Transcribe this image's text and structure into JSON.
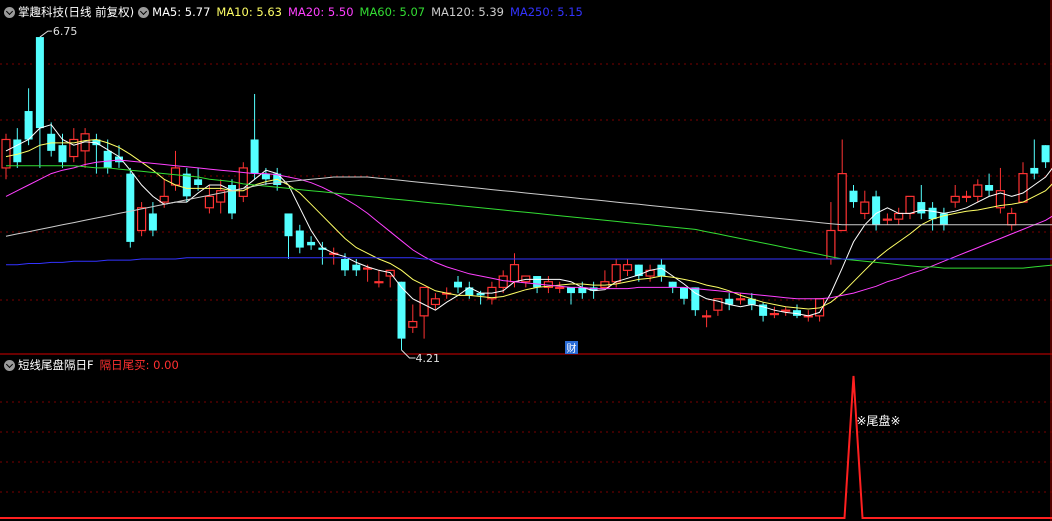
{
  "main_header": {
    "stock_title": "掌趣科技(日线 前复权)",
    "indicators": [
      {
        "label": "MA5: 5.77",
        "color": "#ffffff"
      },
      {
        "label": "MA10: 5.63",
        "color": "#ffff66"
      },
      {
        "label": "MA20: 5.50",
        "color": "#ff40ff"
      },
      {
        "label": "MA60: 5.07",
        "color": "#33dd33"
      },
      {
        "label": "MA120: 5.39",
        "color": "#cccccc"
      },
      {
        "label": "MA250: 5.15",
        "color": "#3333ff"
      }
    ]
  },
  "sub_header": {
    "title": "短线尾盘隔日F",
    "value_label": "隔日尾买: 0.00",
    "value_color": "#ff3030"
  },
  "colors": {
    "up": "#ff3333",
    "down": "#54ffff",
    "grid": "#7a0000",
    "panel_border": "#aa0000",
    "signal": "#ff2020",
    "finance_badge": "#2a6cd6"
  },
  "chart_data": {
    "type": "candlestick",
    "price_range": [
      4.0,
      6.9
    ],
    "high_label": "6.75",
    "low_label": "4.21",
    "finance_marker": {
      "label": "财",
      "at_index": 50
    },
    "candles": [
      [
        5.6,
        5.85,
        5.9,
        5.5
      ],
      [
        5.85,
        5.65,
        5.95,
        5.6
      ],
      [
        6.1,
        5.85,
        6.3,
        5.8
      ],
      [
        6.75,
        5.95,
        6.75,
        5.6
      ],
      [
        5.9,
        5.75,
        6.0,
        5.7
      ],
      [
        5.8,
        5.65,
        5.9,
        5.6
      ],
      [
        5.7,
        5.85,
        5.95,
        5.65
      ],
      [
        5.75,
        5.9,
        5.95,
        5.6
      ],
      [
        5.85,
        5.8,
        5.9,
        5.55
      ],
      [
        5.75,
        5.6,
        5.85,
        5.55
      ],
      [
        5.7,
        5.65,
        5.8,
        5.6
      ],
      [
        5.55,
        4.95,
        5.6,
        4.9
      ],
      [
        5.05,
        5.25,
        5.3,
        5.0
      ],
      [
        5.2,
        5.05,
        5.3,
        5.0
      ],
      [
        5.3,
        5.35,
        5.5,
        5.25
      ],
      [
        5.45,
        5.6,
        5.75,
        5.4
      ],
      [
        5.55,
        5.35,
        5.6,
        5.3
      ],
      [
        5.5,
        5.45,
        5.6,
        5.4
      ],
      [
        5.25,
        5.35,
        5.45,
        5.2
      ],
      [
        5.3,
        5.4,
        5.5,
        5.2
      ],
      [
        5.45,
        5.2,
        5.5,
        5.15
      ],
      [
        5.35,
        5.6,
        5.65,
        5.3
      ],
      [
        5.85,
        5.55,
        6.25,
        5.5
      ],
      [
        5.55,
        5.5,
        5.6,
        5.45
      ],
      [
        5.55,
        5.45,
        5.6,
        5.4
      ],
      [
        5.2,
        5.0,
        5.2,
        4.8
      ],
      [
        5.05,
        4.9,
        5.1,
        4.85
      ],
      [
        4.95,
        4.92,
        5.0,
        4.88
      ],
      [
        4.9,
        4.88,
        4.95,
        4.75
      ],
      [
        4.85,
        4.85,
        4.9,
        4.75
      ],
      [
        4.8,
        4.7,
        4.85,
        4.65
      ],
      [
        4.75,
        4.7,
        4.8,
        4.65
      ],
      [
        4.72,
        4.72,
        4.75,
        4.6
      ],
      [
        4.6,
        4.6,
        4.7,
        4.55
      ],
      [
        4.65,
        4.7,
        4.7,
        4.55
      ],
      [
        4.6,
        4.1,
        4.6,
        4.0
      ],
      [
        4.2,
        4.25,
        4.4,
        4.15
      ],
      [
        4.3,
        4.55,
        4.55,
        4.1
      ],
      [
        4.4,
        4.45,
        4.5,
        4.35
      ],
      [
        4.5,
        4.5,
        4.55,
        4.45
      ],
      [
        4.6,
        4.55,
        4.65,
        4.5
      ],
      [
        4.55,
        4.48,
        4.6,
        4.45
      ],
      [
        4.5,
        4.48,
        4.52,
        4.4
      ],
      [
        4.45,
        4.55,
        4.6,
        4.4
      ],
      [
        4.55,
        4.65,
        4.7,
        4.5
      ],
      [
        4.6,
        4.75,
        4.85,
        4.55
      ],
      [
        4.6,
        4.65,
        4.65,
        4.55
      ],
      [
        4.65,
        4.55,
        4.6,
        4.5
      ],
      [
        4.55,
        4.6,
        4.65,
        4.5
      ],
      [
        4.55,
        4.55,
        4.6,
        4.5
      ],
      [
        4.55,
        4.5,
        4.55,
        4.4
      ],
      [
        4.55,
        4.5,
        4.6,
        4.45
      ],
      [
        4.55,
        4.52,
        4.6,
        4.45
      ],
      [
        4.55,
        4.6,
        4.7,
        4.55
      ],
      [
        4.6,
        4.75,
        4.8,
        4.55
      ],
      [
        4.7,
        4.75,
        4.8,
        4.65
      ],
      [
        4.75,
        4.65,
        4.75,
        4.6
      ],
      [
        4.65,
        4.7,
        4.75,
        4.6
      ],
      [
        4.75,
        4.65,
        4.8,
        4.6
      ],
      [
        4.6,
        4.55,
        4.6,
        4.5
      ],
      [
        4.55,
        4.45,
        4.55,
        4.4
      ],
      [
        4.55,
        4.35,
        4.55,
        4.3
      ],
      [
        4.3,
        4.3,
        4.35,
        4.2
      ],
      [
        4.35,
        4.45,
        4.45,
        4.3
      ],
      [
        4.45,
        4.4,
        4.5,
        4.35
      ],
      [
        4.45,
        4.45,
        4.5,
        4.4
      ],
      [
        4.45,
        4.4,
        4.5,
        4.35
      ],
      [
        4.4,
        4.3,
        4.42,
        4.25
      ],
      [
        4.32,
        4.32,
        4.38,
        4.28
      ],
      [
        4.35,
        4.35,
        4.38,
        4.3
      ],
      [
        4.35,
        4.3,
        4.4,
        4.28
      ],
      [
        4.3,
        4.3,
        4.35,
        4.25
      ],
      [
        4.3,
        4.45,
        4.45,
        4.25
      ],
      [
        4.8,
        5.05,
        5.3,
        4.75
      ],
      [
        5.05,
        5.55,
        5.85,
        5.05
      ],
      [
        5.4,
        5.3,
        5.45,
        5.25
      ],
      [
        5.2,
        5.3,
        5.4,
        5.15
      ],
      [
        5.35,
        5.1,
        5.4,
        5.05
      ],
      [
        5.15,
        5.15,
        5.2,
        5.1
      ],
      [
        5.15,
        5.2,
        5.25,
        5.1
      ],
      [
        5.2,
        5.35,
        5.35,
        5.15
      ],
      [
        5.3,
        5.2,
        5.45,
        5.15
      ],
      [
        5.25,
        5.15,
        5.3,
        5.05
      ],
      [
        5.2,
        5.1,
        5.25,
        5.05
      ],
      [
        5.3,
        5.35,
        5.45,
        5.25
      ],
      [
        5.35,
        5.35,
        5.4,
        5.3
      ],
      [
        5.35,
        5.45,
        5.5,
        5.3
      ],
      [
        5.45,
        5.4,
        5.55,
        5.35
      ],
      [
        5.25,
        5.4,
        5.6,
        5.2
      ],
      [
        5.1,
        5.2,
        5.25,
        5.05
      ],
      [
        5.3,
        5.55,
        5.65,
        5.3
      ],
      [
        5.6,
        5.55,
        5.85,
        5.5
      ],
      [
        5.8,
        5.65,
        5.8,
        5.6
      ],
      [
        5.65,
        5.77,
        5.85,
        5.6
      ]
    ],
    "moving_averages": [
      {
        "name": "MA5",
        "color": "#ffffff",
        "values": [
          5.75,
          5.8,
          5.85,
          5.95,
          5.98,
          5.85,
          5.8,
          5.83,
          5.82,
          5.76,
          5.7,
          5.58,
          5.45,
          5.35,
          5.28,
          5.3,
          5.3,
          5.38,
          5.45,
          5.45,
          5.4,
          5.42,
          5.5,
          5.58,
          5.55,
          5.45,
          5.25,
          5.05,
          4.9,
          4.85,
          4.82,
          4.77,
          4.73,
          4.7,
          4.68,
          4.55,
          4.45,
          4.4,
          4.35,
          4.42,
          4.48,
          4.55,
          4.5,
          4.5,
          4.52,
          4.6,
          4.62,
          4.62,
          4.62,
          4.62,
          4.6,
          4.55,
          4.52,
          4.53,
          4.6,
          4.63,
          4.66,
          4.7,
          4.72,
          4.65,
          4.58,
          4.5,
          4.45,
          4.43,
          4.4,
          4.38,
          4.4,
          4.38,
          4.35,
          4.33,
          4.32,
          4.3,
          4.33,
          4.5,
          4.72,
          4.95,
          5.1,
          5.2,
          5.25,
          5.2,
          5.2,
          5.23,
          5.22,
          5.2,
          5.22,
          5.25,
          5.3,
          5.35,
          5.38,
          5.35,
          5.38,
          5.45,
          5.52,
          5.65
        ]
      },
      {
        "name": "MA10",
        "color": "#ffff66",
        "values": [
          5.7,
          5.72,
          5.75,
          5.8,
          5.82,
          5.82,
          5.82,
          5.84,
          5.85,
          5.82,
          5.78,
          5.72,
          5.65,
          5.58,
          5.5,
          5.45,
          5.42,
          5.42,
          5.42,
          5.42,
          5.4,
          5.4,
          5.45,
          5.48,
          5.5,
          5.45,
          5.38,
          5.28,
          5.18,
          5.08,
          4.98,
          4.9,
          4.85,
          4.8,
          4.76,
          4.7,
          4.62,
          4.57,
          4.52,
          4.5,
          4.48,
          4.48,
          4.47,
          4.46,
          4.47,
          4.5,
          4.53,
          4.55,
          4.56,
          4.57,
          4.58,
          4.58,
          4.57,
          4.57,
          4.58,
          4.6,
          4.62,
          4.63,
          4.65,
          4.64,
          4.62,
          4.6,
          4.57,
          4.55,
          4.52,
          4.48,
          4.45,
          4.42,
          4.4,
          4.38,
          4.37,
          4.36,
          4.37,
          4.42,
          4.5,
          4.6,
          4.7,
          4.8,
          4.88,
          4.95,
          5.02,
          5.1,
          5.15,
          5.18,
          5.2,
          5.22,
          5.23,
          5.25,
          5.27,
          5.28,
          5.3,
          5.35,
          5.4,
          5.5
        ]
      },
      {
        "name": "MA20",
        "color": "#ff40ff",
        "values": [
          5.35,
          5.4,
          5.45,
          5.5,
          5.55,
          5.58,
          5.6,
          5.63,
          5.65,
          5.66,
          5.67,
          5.66,
          5.65,
          5.64,
          5.63,
          5.62,
          5.61,
          5.6,
          5.59,
          5.58,
          5.57,
          5.56,
          5.55,
          5.55,
          5.54,
          5.52,
          5.5,
          5.47,
          5.43,
          5.38,
          5.33,
          5.27,
          5.2,
          5.12,
          5.04,
          4.96,
          4.88,
          4.82,
          4.77,
          4.73,
          4.7,
          4.67,
          4.65,
          4.63,
          4.61,
          4.6,
          4.59,
          4.58,
          4.57,
          4.56,
          4.55,
          4.55,
          4.54,
          4.54,
          4.54,
          4.54,
          4.55,
          4.55,
          4.55,
          4.55,
          4.55,
          4.54,
          4.53,
          4.52,
          4.51,
          4.5,
          4.49,
          4.48,
          4.47,
          4.46,
          4.45,
          4.45,
          4.45,
          4.46,
          4.48,
          4.5,
          4.53,
          4.56,
          4.6,
          4.63,
          4.67,
          4.7,
          4.74,
          4.78,
          4.82,
          4.86,
          4.9,
          4.94,
          4.98,
          5.02,
          5.06,
          5.1,
          5.14,
          5.2
        ]
      },
      {
        "name": "MA60",
        "color": "#33dd33",
        "values": [
          5.62,
          5.62,
          5.62,
          5.62,
          5.62,
          5.62,
          5.62,
          5.61,
          5.6,
          5.6,
          5.59,
          5.58,
          5.57,
          5.56,
          5.55,
          5.54,
          5.53,
          5.52,
          5.5,
          5.49,
          5.48,
          5.46,
          5.45,
          5.44,
          5.43,
          5.42,
          5.41,
          5.4,
          5.39,
          5.38,
          5.37,
          5.36,
          5.35,
          5.34,
          5.33,
          5.32,
          5.31,
          5.3,
          5.29,
          5.28,
          5.27,
          5.26,
          5.25,
          5.24,
          5.23,
          5.22,
          5.21,
          5.2,
          5.19,
          5.18,
          5.17,
          5.16,
          5.15,
          5.14,
          5.13,
          5.12,
          5.11,
          5.1,
          5.09,
          5.08,
          5.07,
          5.06,
          5.04,
          5.02,
          5.0,
          4.98,
          4.96,
          4.94,
          4.92,
          4.9,
          4.88,
          4.86,
          4.84,
          4.82,
          4.8,
          4.79,
          4.78,
          4.77,
          4.76,
          4.75,
          4.74,
          4.73,
          4.73,
          4.72,
          4.72,
          4.72,
          4.72,
          4.72,
          4.72,
          4.72,
          4.72,
          4.73,
          4.74,
          4.75
        ]
      },
      {
        "name": "MA120",
        "color": "#cccccc",
        "values": [
          5.0,
          5.02,
          5.04,
          5.06,
          5.08,
          5.1,
          5.12,
          5.14,
          5.16,
          5.18,
          5.2,
          5.22,
          5.24,
          5.26,
          5.28,
          5.3,
          5.32,
          5.34,
          5.36,
          5.38,
          5.4,
          5.42,
          5.44,
          5.46,
          5.47,
          5.48,
          5.49,
          5.5,
          5.51,
          5.52,
          5.52,
          5.52,
          5.52,
          5.51,
          5.5,
          5.49,
          5.48,
          5.47,
          5.46,
          5.45,
          5.44,
          5.43,
          5.42,
          5.41,
          5.4,
          5.39,
          5.38,
          5.37,
          5.36,
          5.35,
          5.34,
          5.33,
          5.32,
          5.31,
          5.3,
          5.29,
          5.28,
          5.27,
          5.26,
          5.25,
          5.24,
          5.23,
          5.22,
          5.21,
          5.2,
          5.19,
          5.18,
          5.17,
          5.16,
          5.15,
          5.14,
          5.13,
          5.12,
          5.11,
          5.1,
          5.1,
          5.1,
          5.1,
          5.1,
          5.1,
          5.1,
          5.1,
          5.1,
          5.1,
          5.1,
          5.1,
          5.1,
          5.1,
          5.1,
          5.1,
          5.1,
          5.1,
          5.1,
          5.1
        ]
      },
      {
        "name": "MA250",
        "color": "#3333ff",
        "values": [
          4.75,
          4.75,
          4.76,
          4.76,
          4.77,
          4.77,
          4.78,
          4.78,
          4.78,
          4.79,
          4.79,
          4.79,
          4.8,
          4.8,
          4.8,
          4.8,
          4.81,
          4.81,
          4.81,
          4.81,
          4.81,
          4.81,
          4.81,
          4.81,
          4.81,
          4.81,
          4.81,
          4.81,
          4.81,
          4.81,
          4.81,
          4.81,
          4.81,
          4.81,
          4.81,
          4.81,
          4.81,
          4.8,
          4.8,
          4.8,
          4.8,
          4.8,
          4.8,
          4.8,
          4.8,
          4.8,
          4.8,
          4.8,
          4.8,
          4.8,
          4.8,
          4.8,
          4.8,
          4.8,
          4.8,
          4.8,
          4.8,
          4.8,
          4.8,
          4.8,
          4.8,
          4.8,
          4.8,
          4.8,
          4.8,
          4.8,
          4.8,
          4.8,
          4.8,
          4.8,
          4.8,
          4.8,
          4.8,
          4.8,
          4.8,
          4.8,
          4.8,
          4.8,
          4.8,
          4.8,
          4.8,
          4.8,
          4.8,
          4.8,
          4.8,
          4.8,
          4.8,
          4.8,
          4.8,
          4.8,
          4.8,
          4.8,
          4.8,
          4.8
        ]
      }
    ],
    "indicator": {
      "name": "短线尾盘隔日F",
      "signal_label": "※尾盘※",
      "signal_index": 75,
      "signal_value": 1
    }
  }
}
